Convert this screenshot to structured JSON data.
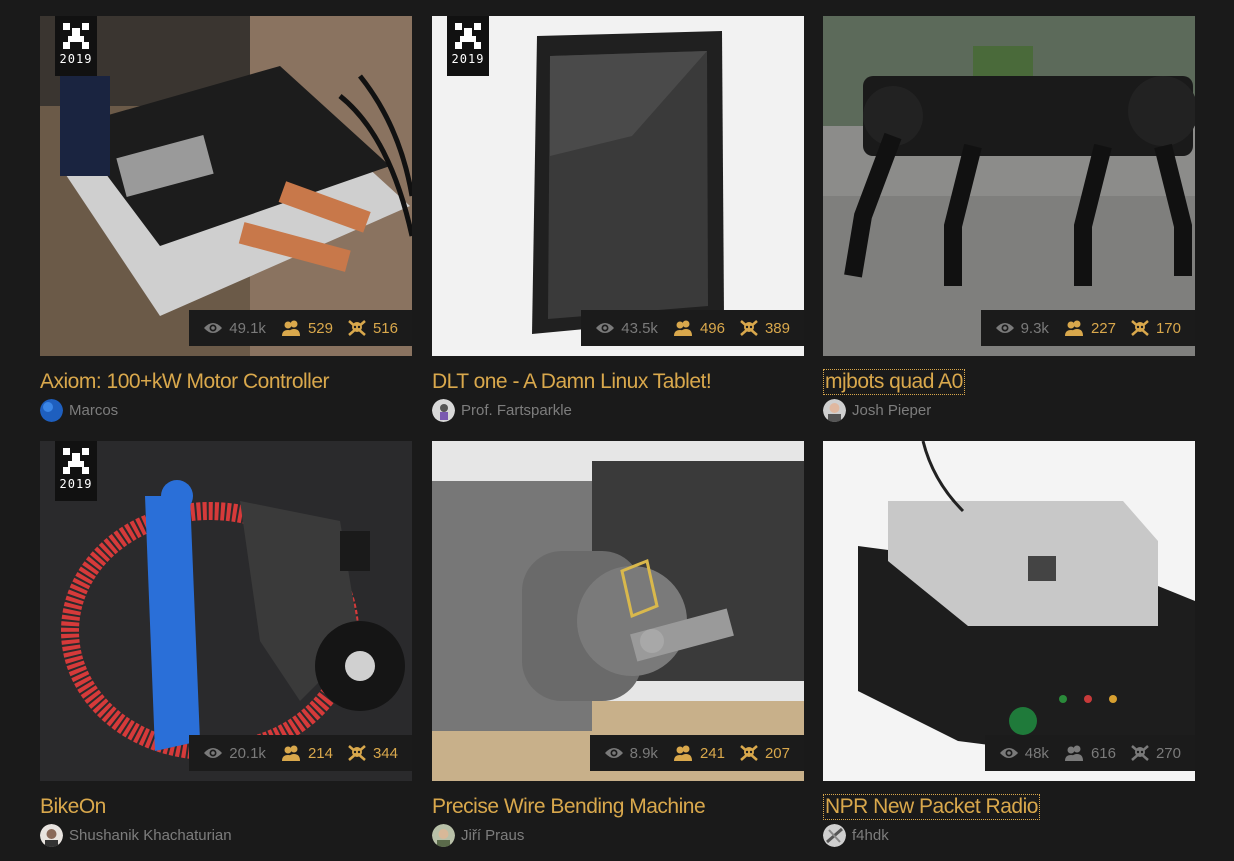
{
  "projects": [
    {
      "title": "Axiom: 100+kW Motor Controller",
      "author": "Marcos",
      "badge_year": "2019",
      "views": "49.1k",
      "followers": "529",
      "skulls": "516",
      "accent": "#d9a84c"
    },
    {
      "title": "DLT one - A Damn Linux Tablet!",
      "author": "Prof. Fartsparkle",
      "badge_year": "2019",
      "views": "43.5k",
      "followers": "496",
      "skulls": "389",
      "accent": "#d9a84c"
    },
    {
      "title": "mjbots quad A0",
      "author": "Josh Pieper",
      "views": "9.3k",
      "followers": "227",
      "skulls": "170",
      "accent": "#d9a84c"
    },
    {
      "title": "BikeOn",
      "author": "Shushanik Khachaturian",
      "badge_year": "2019",
      "views": "20.1k",
      "followers": "214",
      "skulls": "344",
      "accent": "#d9a84c"
    },
    {
      "title": "Precise Wire Bending Machine",
      "author": "Jiří Praus",
      "views": "8.9k",
      "followers": "241",
      "skulls": "207",
      "accent": "#d9a84c"
    },
    {
      "title": "NPR New Packet Radio",
      "author": "f4hdk",
      "views": "48k",
      "followers": "616",
      "skulls": "270",
      "accent": "#7a7a7a"
    }
  ],
  "icons": {
    "views": "eye-icon",
    "followers": "followers-icon",
    "skulls": "skull-icon",
    "badge": "hackaday-prize-icon"
  }
}
